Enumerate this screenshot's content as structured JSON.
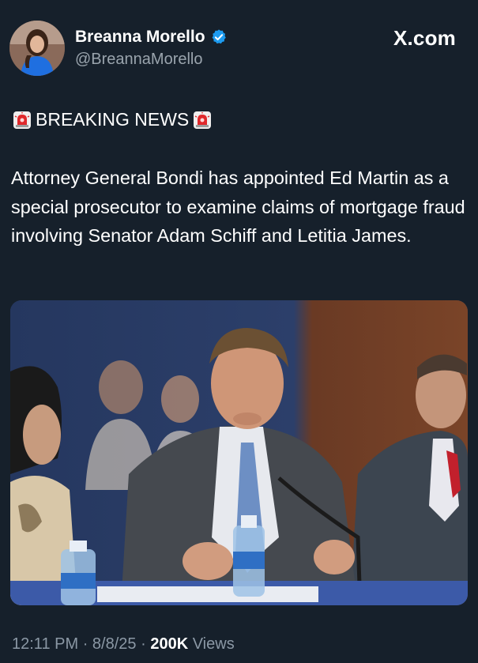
{
  "author": {
    "display_name": "Breanna Morello",
    "handle": "@BreannaMorello",
    "verified": true
  },
  "brand": "X.com",
  "tweet": {
    "headline": "BREAKING NEWS",
    "headline_icon": "police-siren-emoji",
    "body": "Attorney General Bondi has appointed Ed Martin as a special prosecutor to examine claims of mortgage fraud involving Senator Adam Schiff and Letitia James.",
    "photo_description_icon": "hearing-photo"
  },
  "meta": {
    "time": "12:11 PM",
    "separator": "·",
    "date": "8/8/25",
    "views_count": "200K",
    "views_label": "Views"
  },
  "colors": {
    "background": "#16202b",
    "verified_badge": "#1d9bf0",
    "muted_text": "#8b98a5"
  }
}
